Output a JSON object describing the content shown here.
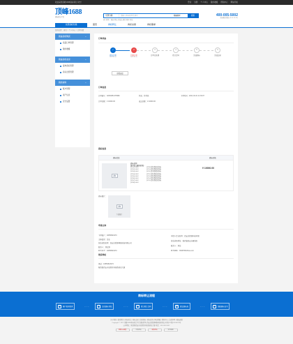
{
  "topbar": {
    "welcome": "欢迎来到顶峰1688商标转让平台！",
    "links": [
      "登录",
      "注册",
      "个人中心",
      "我的收藏",
      "帮助中心",
      "网站导航"
    ]
  },
  "header": {
    "logo_main": "顶峰1688",
    "logo_sub": "商标转让平台",
    "search_select": "全部分类",
    "search_placeholder": "请输入商标名称/注册号",
    "search_check": "精确搜索",
    "search_button": "搜索",
    "hot": "热门搜索：服装 食品 化妆品 餐饮 教育 科技",
    "phone": "400-005-5002",
    "phone_note": "全国服务热线 (9:00-18:00)"
  },
  "nav": {
    "category": "全部商标分类",
    "items": [
      {
        "label": "首页",
        "active": false
      },
      {
        "label": "商标转让",
        "active": true
      },
      {
        "label": "商标交易",
        "active": false
      },
      {
        "label": "商标需求",
        "active": false
      }
    ]
  },
  "breadcrumb": "您的位置：首页 > 个人中心 > 订单详情",
  "sidebar": {
    "groups": [
      {
        "title": "我是商标购买",
        "items": [
          "商品订单管理",
          "我的收藏"
        ]
      },
      {
        "title": "我是商标卖家",
        "items": [
          "发布商标管理",
          "商标出售管理"
        ]
      },
      {
        "title": "我的资料",
        "items": [
          "账户管理",
          "资产信息",
          "安全设置"
        ]
      }
    ]
  },
  "order": {
    "status_title": "订单状态",
    "steps": [
      {
        "label": "提交订单",
        "date": "2021-03-31",
        "state": "done"
      },
      {
        "label": "付款订单",
        "date": "2021-03-31",
        "state": "current"
      },
      {
        "label": "订单已处理",
        "date": "",
        "state": "todo"
      },
      {
        "label": "签订合同",
        "date": "",
        "state": "todo"
      },
      {
        "label": "完成商标",
        "date": "",
        "state": "todo"
      },
      {
        "label": "完成交易",
        "date": "",
        "state": "todo"
      }
    ],
    "view_progress": "查看进度",
    "info_title": "订单信息",
    "order_no": "订单编号：32084651378980",
    "order_state": "状态：待付款",
    "order_time": "下单时间：2021-03-31 11:39:07",
    "order_amount": "订单金额：¥ 10000.00",
    "deal_amount": "成交金额：¥ 10000.00",
    "tm_title": "商标信息",
    "th_info": "商标信息",
    "th_price": "商标价格",
    "tm_name": "商标名称",
    "tm_class": "第37类 (建筑修缮)",
    "tm_items": [
      "[3701] 0002",
      "[3702] 0002",
      "[3703] 0002",
      "[3704] 0002",
      "[3705] 0002",
      "[3706] 0002",
      "[3707] 0002",
      "[3708] 0002"
    ],
    "tm_items2": [
      "[3709] 第1类相关商标",
      "[3710] 第1类相关商标",
      "[3711] 第1类相关商标",
      "[3712] 第1类相关商标",
      "[3713] 第1类相关商标",
      "[3714] 第1类相关商标",
      "[3715] 第1类相关商标"
    ],
    "tm_price": "¥ 10000.00",
    "attachment_label": "商标图片：",
    "no_image": "下载图片",
    "buyer_title": "申请主体",
    "buyer_left": [
      "下单账户：18659523270",
      "主体类型：企业",
      "营业执照名称：西安佳德源网络科技有限公司",
      "联系人：测试测",
      "联系电话：18659523270",
      "证件照片/营业执照："
    ],
    "buyer_right": [
      "申请人企业名称：西安佳德源科技有限",
      "营业执照地址：陕西省西安市雁塔区",
      "联系人：测试",
      "联系邮箱：35387593@qq.com"
    ],
    "address_title": "收货地址",
    "address_lines": [
      "测试：18659523270",
      "陕西省西安市高新区科技路创业大厦"
    ]
  },
  "footer": {
    "title": "商标转让流程",
    "steps": [
      "客户咨询需求",
      "合适商标评估",
      "签订转让合同",
      "提交商标局",
      "领取商标证书"
    ],
    "step_icons": [
      "☏",
      "✎",
      "✉",
      "▤",
      "✔"
    ],
    "links": "关于我们 | 联系我们 | 商标转让 | 商标交易 | 注册商标 | 商标查询 | 网站地图 | 帮助中心 | 法律声明 | 隐私政策",
    "copyright": "Copyright © 2021 顶峰1688商标转让平台 版权所有 西安佳德源网络科技有限公司 陕ICP备12345678号",
    "address": "公司地址：陕西省西安市高新区科技路创业大厦 电话：400-005-5002",
    "badges": [
      "网络110报警",
      "可信网站",
      "诚信网站",
      "安全联盟"
    ]
  },
  "colors": {
    "primary": "#0b6fd2",
    "accent_red": "#e84a4a",
    "sidebar_head": "#4590da"
  }
}
